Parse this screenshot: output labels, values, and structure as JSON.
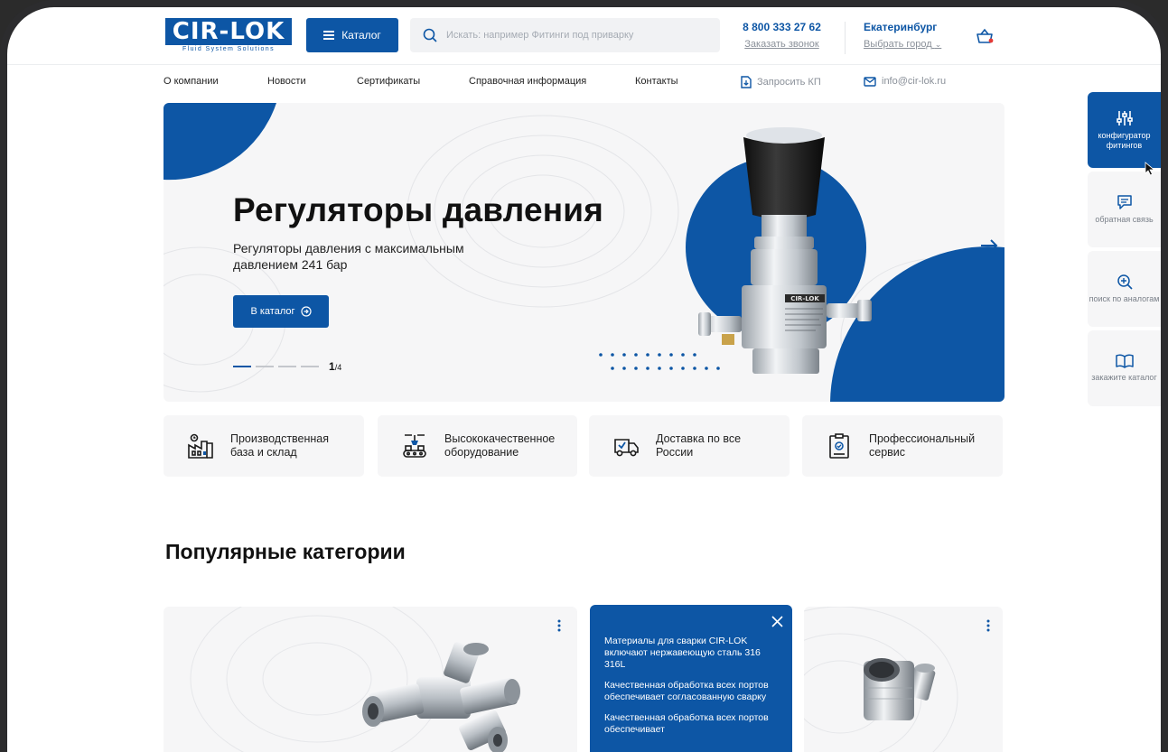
{
  "header": {
    "logo_text": "CIR-LOK",
    "logo_sub": "Fluid System Solutions",
    "catalog_label": "Каталог",
    "search_placeholder": "Искать: например Фитинги под приварку",
    "phone": "8 800 333 27 62",
    "callback": "Заказать звонок",
    "city": "Екатеринбург",
    "city_pick": "Выбрать город"
  },
  "nav": {
    "items": [
      "О компании",
      "Новости",
      "Сертификаты",
      "Справочная информация",
      "Контакты"
    ],
    "request": "Запросить КП",
    "email": "info@cir-lok.ru"
  },
  "hero": {
    "title": "Регуляторы давления",
    "subtitle": "Регуляторы давления с максимальным давлением 241 бар",
    "button": "В каталог",
    "page_current": "1",
    "page_total": "/4",
    "product_label": "CIR-LOK"
  },
  "side": [
    {
      "icon": "sliders-icon",
      "label": "конфигуратор фитингов"
    },
    {
      "icon": "chat-icon",
      "label": "обратная связь"
    },
    {
      "icon": "zoom-plus-icon",
      "label": "поиск по аналогам"
    },
    {
      "icon": "book-icon",
      "label": "закажите каталог"
    }
  ],
  "features": [
    {
      "icon": "factory-icon",
      "label": "Производственная\nбаза и склад"
    },
    {
      "icon": "conveyor-icon",
      "label": "Высококачественное\nоборудование"
    },
    {
      "icon": "truck-icon",
      "label": "Доставка по все\nРоссии"
    },
    {
      "icon": "certificate-icon",
      "label": "Профессиональный\nсервис"
    }
  ],
  "popular": {
    "title": "Популярные категории",
    "tooltip": [
      "Материалы для сварки CIR-LOK включают нержавеющую сталь 316 316L",
      "Качественная обработка всех портов обеспечивает согласованную сварку",
      "Качественная обработка всех портов обеспечивает"
    ]
  },
  "colors": {
    "brand": "#0d56a5",
    "panel": "#f6f6f7"
  }
}
